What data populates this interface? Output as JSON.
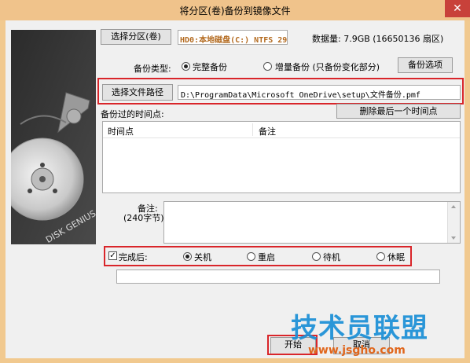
{
  "window": {
    "title": "将分区(卷)备份到镜像文件",
    "close_glyph": "✕"
  },
  "partition": {
    "select_button": "选择分区(卷)",
    "selected": "HD0:本地磁盘(C:) NTFS 29",
    "size_info": "数据量: 7.9GB (16650136 扇区)"
  },
  "backup_type": {
    "label": "备份类型:",
    "options": [
      {
        "label": "完整备份",
        "checked": true
      },
      {
        "label": "增量备份 (只备份变化部分)",
        "checked": false
      }
    ],
    "options_button": "备份选项"
  },
  "file_path": {
    "select_button": "选择文件路径",
    "value": "D:\\ProgramData\\Microsoft OneDrive\\setup\\文件备份.pmf"
  },
  "history": {
    "label": "备份过的时间点:",
    "delete_button": "删除最后一个时间点",
    "columns": [
      "时间点",
      "备注"
    ]
  },
  "note": {
    "label": "备注:",
    "sublabel": "(240字节)",
    "value": ""
  },
  "after_completion": {
    "checkbox_label": "完成后:",
    "checked": true,
    "options": [
      {
        "label": "关机",
        "checked": true
      },
      {
        "label": "重启",
        "checked": false
      },
      {
        "label": "待机",
        "checked": false
      },
      {
        "label": "休眠",
        "checked": false
      }
    ]
  },
  "progress": {
    "value": 0
  },
  "footer": {
    "start_button": "开始",
    "cancel_button": "取消"
  },
  "sidebar_art": {
    "brand_text": "DISK GENIUS"
  },
  "watermark": {
    "text": "技术员联盟",
    "url": "www.jsgho.com"
  }
}
